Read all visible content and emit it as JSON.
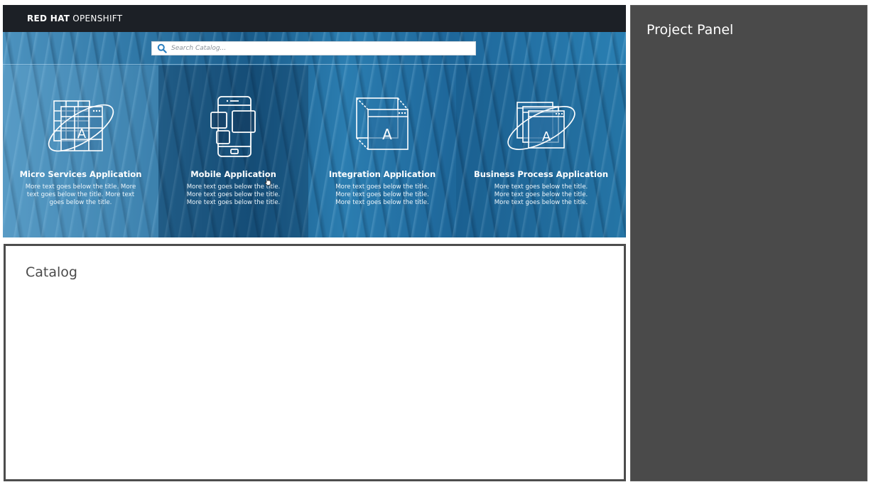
{
  "header": {
    "brand_bold": "RED HAT",
    "brand_light": "OPENSHIFT"
  },
  "search": {
    "placeholder": "Search Catalog..."
  },
  "tiles": [
    {
      "title": "Micro Services Application",
      "description": "More text goes below the title. More text goes below the title. More text goes below the title.",
      "icon": "microservices-icon"
    },
    {
      "title": "Mobile Application",
      "description": "More text goes below the title. More text goes below the title. More text goes below the title.",
      "icon": "mobile-icon"
    },
    {
      "title": "Integration Application",
      "description": "More text goes below the title. More text goes below the title. More text goes below the title.",
      "icon": "integration-icon"
    },
    {
      "title": "Business Process Application",
      "description": "More text goes below the title. More text goes below the title. More text goes below the title.",
      "icon": "business-process-icon"
    }
  ],
  "catalog": {
    "title": "Catalog"
  },
  "project_panel": {
    "title": "Project Panel"
  },
  "colors": {
    "topbar": "#1c2026",
    "hero_blue": "#2f77a6",
    "panel_gray": "#4a4a4a",
    "catalog_border": "#4d4d4d"
  }
}
